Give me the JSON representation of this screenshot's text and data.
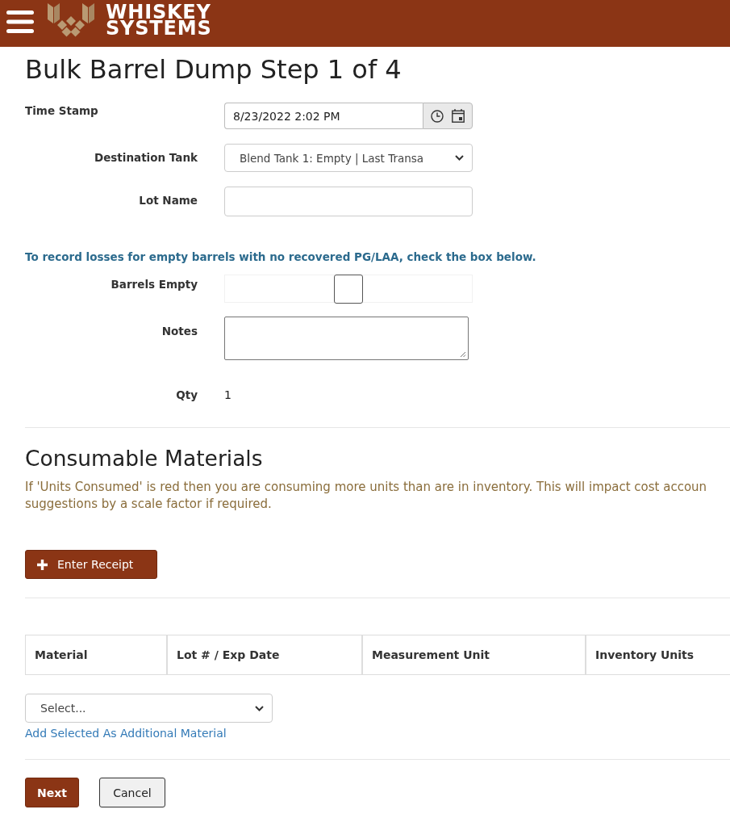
{
  "header": {
    "brand": "WHISKEY SYSTEMS"
  },
  "title": "Bulk Barrel Dump Step 1 of 4",
  "form": {
    "rows": [
      {
        "kind": "datetime",
        "label": "Time Stamp",
        "value": "8/23/2022 2:02 PM"
      },
      {
        "kind": "select",
        "label": "Destination Tank",
        "value": "Blend Tank 1: Empty | Last Transa"
      },
      {
        "kind": "text",
        "label": "Lot Name"
      },
      {
        "kind": "notice",
        "text": "To record losses for empty barrels with no recovered PG/LAA, check the box below."
      },
      {
        "kind": "checkbox",
        "label": "Barrels Empty",
        "checked": false
      },
      {
        "kind": "textarea",
        "label": "Notes"
      },
      {
        "kind": "static",
        "label": "Qty",
        "value": "1"
      }
    ]
  },
  "consumables": {
    "title": "Consumable Materials",
    "warning_lines": [
      "If 'Units Consumed' is red then you are consuming more units than are in inventory. This will impact cost accoun",
      "suggestions by a scale factor if required."
    ],
    "enter_receipt": "Enter Receipt",
    "table": {
      "columns": [
        "Material",
        "Lot # / Exp Date",
        "Measurement Unit",
        "Inventory Units"
      ]
    },
    "material_select": {
      "value": "Select..."
    },
    "add_link": "Add Selected As Additional Material"
  },
  "actions": [
    {
      "kind": "primary",
      "label": "Next"
    },
    {
      "kind": "secondary",
      "label": "Cancel"
    }
  ]
}
